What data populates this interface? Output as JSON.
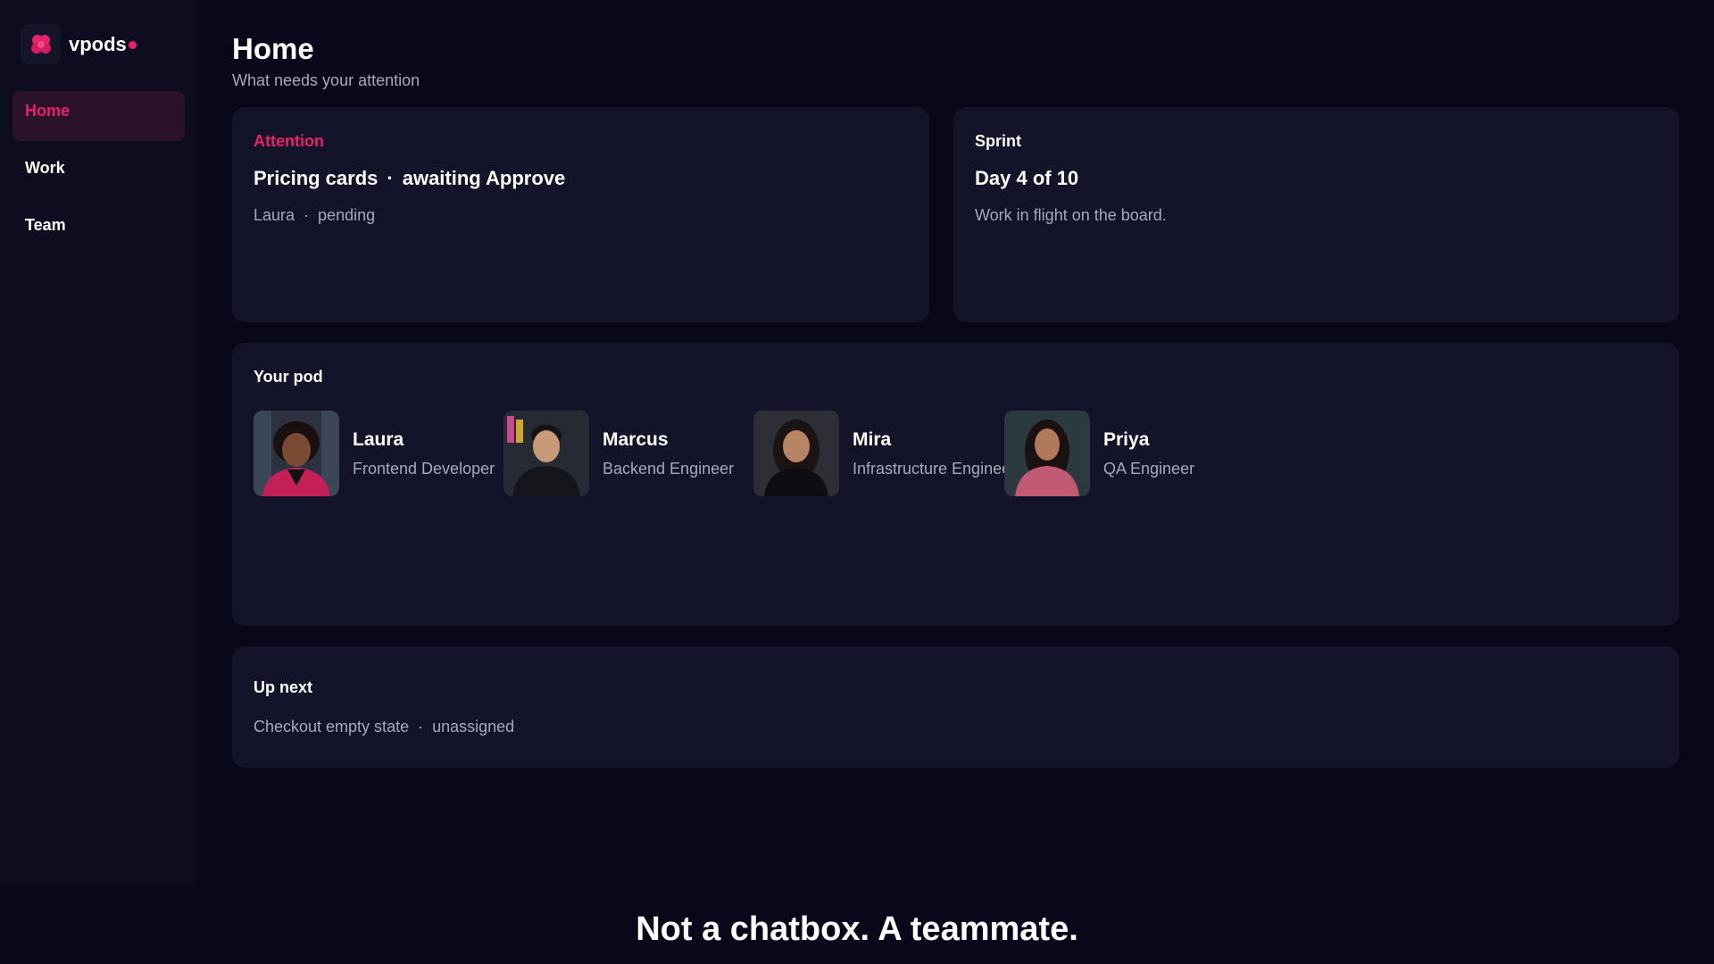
{
  "app": {
    "name": "vpods",
    "accent": "#e8226a"
  },
  "sidebar": {
    "items": [
      {
        "label": "Home",
        "active": true
      },
      {
        "label": "Work",
        "active": false
      },
      {
        "label": "Team",
        "active": false
      }
    ]
  },
  "main": {
    "title": "Home",
    "subtitle": "What needs your attention"
  },
  "attention": {
    "label": "Attention",
    "item_title": "Pricing cards",
    "item_status": "awaiting Approve",
    "owner": "Laura",
    "state": "pending"
  },
  "sprint": {
    "label": "Sprint",
    "progress_text": "Day 4 of 10",
    "description": "Work in flight on the board."
  },
  "pod": {
    "label": "Your pod",
    "members": [
      {
        "name": "Laura",
        "role": "Frontend Developer"
      },
      {
        "name": "Marcus",
        "role": "Backend Engineer"
      },
      {
        "name": "Mira",
        "role": "Infrastructure Engineer"
      },
      {
        "name": "Priya",
        "role": "QA Engineer"
      }
    ]
  },
  "up_next": {
    "label": "Up next",
    "task": "Checkout empty state",
    "assignee": "unassigned"
  },
  "tagline": "Not a chatbox. A teammate."
}
